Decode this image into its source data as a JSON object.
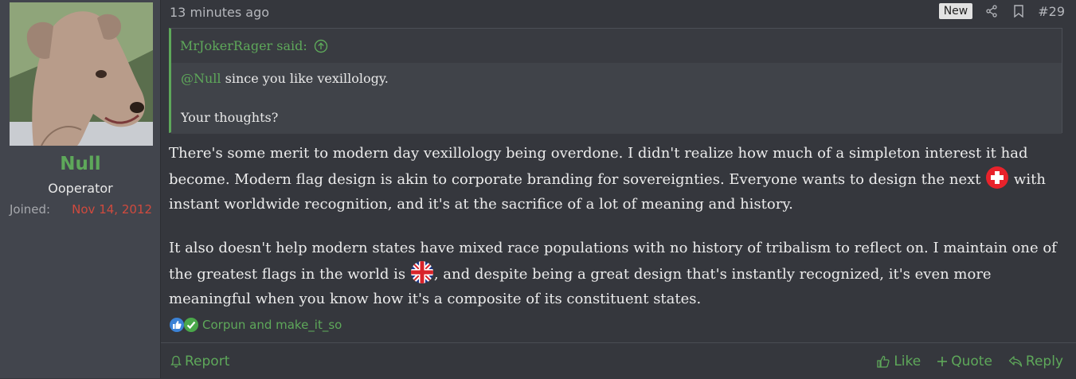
{
  "user": {
    "name": "Null",
    "title": "Ooperator",
    "joined_label": "Joined:",
    "joined_date": "Nov 14, 2012",
    "name_color": "#5ea85a",
    "joined_color": "#d04a3e"
  },
  "post": {
    "timestamp": "13 minutes ago",
    "new_badge": "New",
    "number": "#29",
    "share_icon": "share-icon",
    "bookmark_icon": "bookmark-icon"
  },
  "quote": {
    "author_line": "MrJokerRager said:",
    "mention": "@Null",
    "line1_rest": " since you like vexillology.",
    "line2": "Your thoughts?"
  },
  "content": {
    "p1_a": "There's some merit to modern day vexillology being overdone. I didn't realize how much of a simpleton interest it had become. Modern flag design is akin to corporate branding for sovereignties. Everyone wants to design the next ",
    "p1_b": " with instant worldwide recognition, and it's at the sacrifice of a lot of meaning and history.",
    "p2_a": "It also doesn't help modern states have mixed race populations with no history of tribalism to reflect on. I maintain one of the greatest flags in the world is ",
    "p2_b": ", and despite being a great design that's instantly recognized, it's even more meaningful when you know how it's a composite of its constituent states.",
    "flag1": "swiss-flag-emoji",
    "flag2": "uk-flag-emoji"
  },
  "reactions": {
    "text": "Corpun and make_it_so"
  },
  "footer": {
    "report": "Report",
    "like": "Like",
    "quote": "Quote",
    "reply": "Reply"
  },
  "colors": {
    "accent": "#5ea85a",
    "background": "#35373d",
    "sidebar": "#42454d"
  }
}
